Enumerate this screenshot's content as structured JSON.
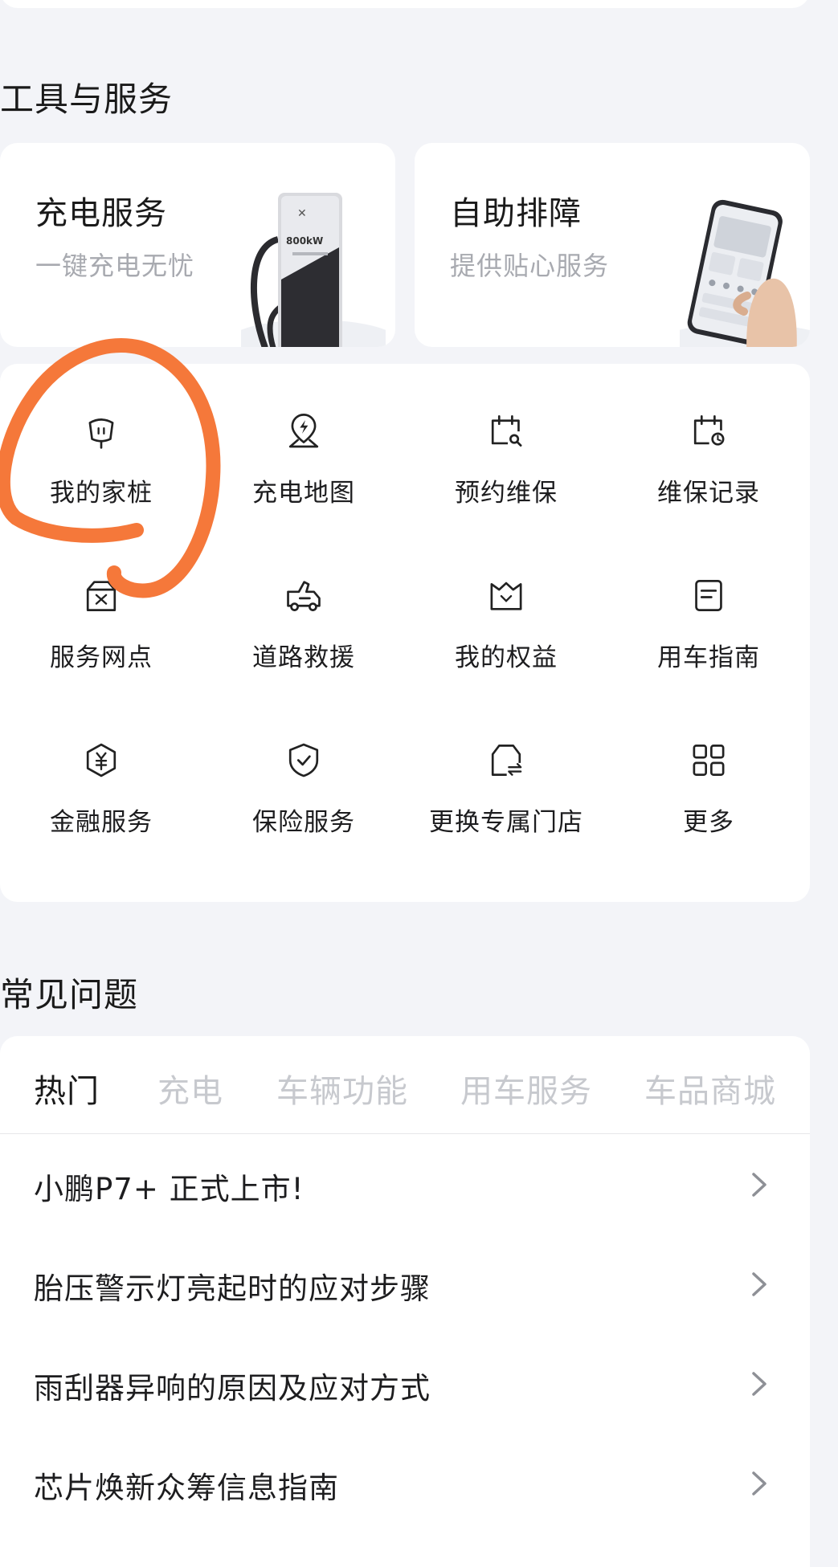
{
  "sections": {
    "tools_title": "工具与服务",
    "faq_title": "常见问题"
  },
  "promos": [
    {
      "title": "充电服务",
      "subtitle": "一键充电无忧",
      "icon": "charger-image",
      "charger_badge": "800kW"
    },
    {
      "title": "自助排障",
      "subtitle": "提供贴心服务",
      "icon": "phone-image"
    }
  ],
  "services": [
    {
      "label": "我的家桩",
      "icon": "home-charger-icon"
    },
    {
      "label": "充电地图",
      "icon": "charging-map-icon"
    },
    {
      "label": "预约维保",
      "icon": "maintenance-booking-icon"
    },
    {
      "label": "维保记录",
      "icon": "maintenance-record-icon"
    },
    {
      "label": "服务网点",
      "icon": "service-outlet-icon"
    },
    {
      "label": "道路救援",
      "icon": "road-rescue-icon"
    },
    {
      "label": "我的权益",
      "icon": "my-benefits-icon"
    },
    {
      "label": "用车指南",
      "icon": "car-guide-icon"
    },
    {
      "label": "金融服务",
      "icon": "finance-service-icon"
    },
    {
      "label": "保险服务",
      "icon": "insurance-service-icon"
    },
    {
      "label": "更换专属门店",
      "icon": "change-store-icon"
    },
    {
      "label": "更多",
      "icon": "more-grid-icon"
    }
  ],
  "faq": {
    "tabs": [
      "热门",
      "充电",
      "车辆功能",
      "用车服务",
      "车品商城"
    ],
    "active_tab": "热门",
    "items": [
      "小鹏P7+ 正式上市!",
      "胎压警示灯亮起时的应对步骤",
      "雨刮器异响的原因及应对方式",
      "芯片焕新众筹信息指南"
    ]
  },
  "colors": {
    "background": "#f3f4f8",
    "card": "#ffffff",
    "text": "#1d1d1f",
    "muted": "#a8aab0",
    "tab_inactive": "#c7c9ce",
    "annotation": "#f5783a"
  }
}
